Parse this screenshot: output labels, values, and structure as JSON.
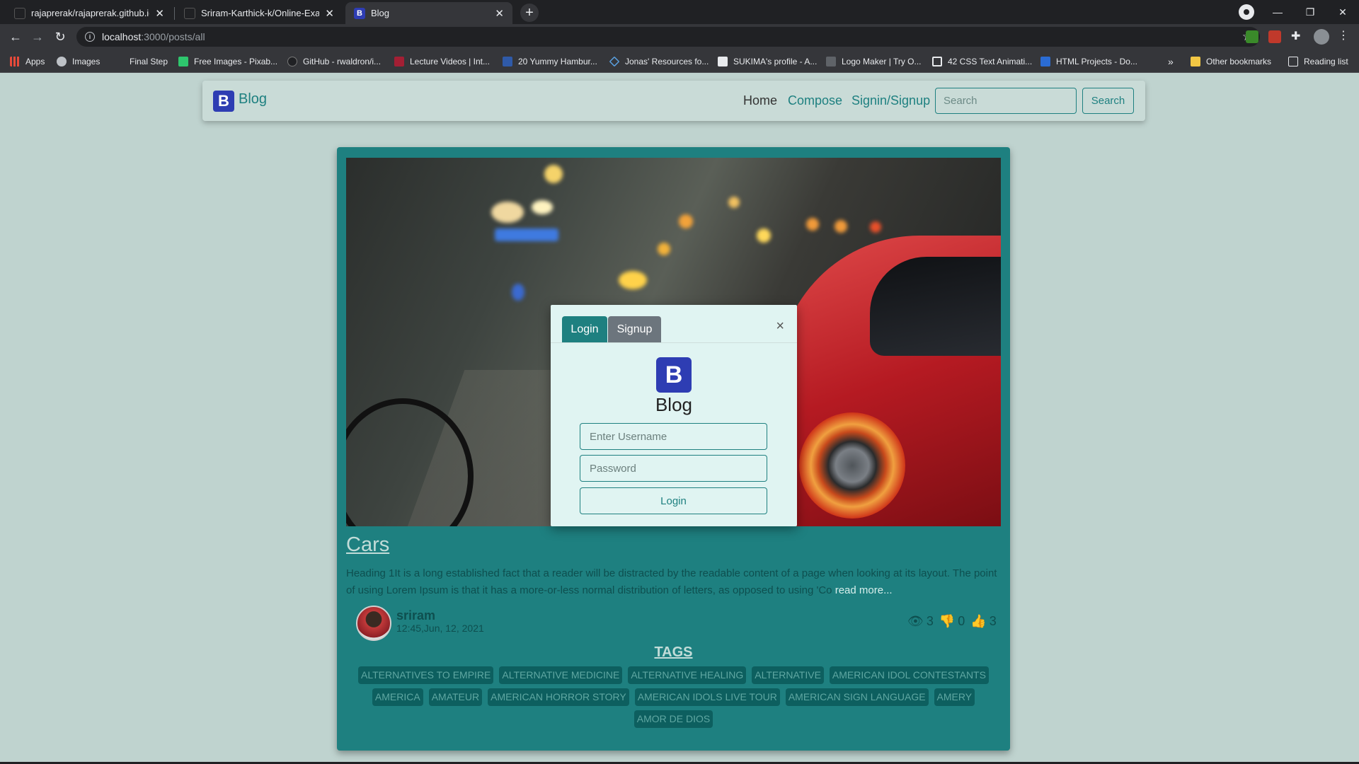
{
  "browser": {
    "tabs": [
      {
        "title": "rajaprerak/rajaprerak.github.io: P"
      },
      {
        "title": "Sriram-Karthick-k/Online-Exam"
      },
      {
        "title": "Blog"
      }
    ],
    "url_host": "localhost",
    "url_path": ":3000/posts/all",
    "bookmarks": [
      {
        "label": "Apps"
      },
      {
        "label": "Images"
      },
      {
        "label": "Final Step"
      },
      {
        "label": "Free Images - Pixab..."
      },
      {
        "label": "GitHub - rwaldron/i..."
      },
      {
        "label": "Lecture Videos | Int..."
      },
      {
        "label": "20 Yummy Hambur..."
      },
      {
        "label": "Jonas' Resources fo..."
      },
      {
        "label": "SUKIMA's profile - A..."
      },
      {
        "label": "Logo Maker | Try O..."
      },
      {
        "label": "42 CSS Text Animati..."
      },
      {
        "label": "HTML Projects - Do..."
      },
      {
        "label": "»"
      },
      {
        "label": "Other bookmarks"
      },
      {
        "label": "Reading list"
      }
    ]
  },
  "navbar": {
    "brand_logo": "B",
    "brand": "Blog",
    "links": {
      "home": "Home",
      "compose": "Compose",
      "signin": "Signin/Signup"
    },
    "search_placeholder": "Search",
    "search_button": "Search"
  },
  "post": {
    "title": "Cars",
    "body": "Heading 1It is a long established fact that a reader will be distracted by the readable content of a page when looking at its layout. The point of using Lorem Ipsum is that it has a more-or-less normal distribution of letters, as opposed to using 'Co",
    "read_more": "read more...",
    "author": "sriram",
    "date": "12:45,Jun, 12, 2021",
    "views": "3",
    "dislikes": "0",
    "likes": "3",
    "tags_title": "TAGS",
    "tags": [
      "ALTERNATIVES TO EMPIRE",
      "ALTERNATIVE MEDICINE",
      "ALTERNATIVE HEALING",
      "ALTERNATIVE",
      "AMERICAN IDOL CONTESTANTS",
      "AMERICA",
      "AMATEUR",
      "AMERICAN HORROR STORY",
      "AMERICAN IDOLS LIVE TOUR",
      "AMERICAN SIGN LANGUAGE",
      "AMERY",
      "AMOR DE DIOS"
    ]
  },
  "modal": {
    "tab_login": "Login",
    "tab_signup": "Signup",
    "close": "×",
    "logo": "B",
    "brand": "Blog",
    "username_placeholder": "Enter Username",
    "password_placeholder": "Password",
    "submit": "Login"
  },
  "colors": {
    "page_bg": "#bfd3cf",
    "card_bg": "#1e8080",
    "brand_blue": "#2e3db3",
    "modal_bg": "#e0f4f2"
  }
}
